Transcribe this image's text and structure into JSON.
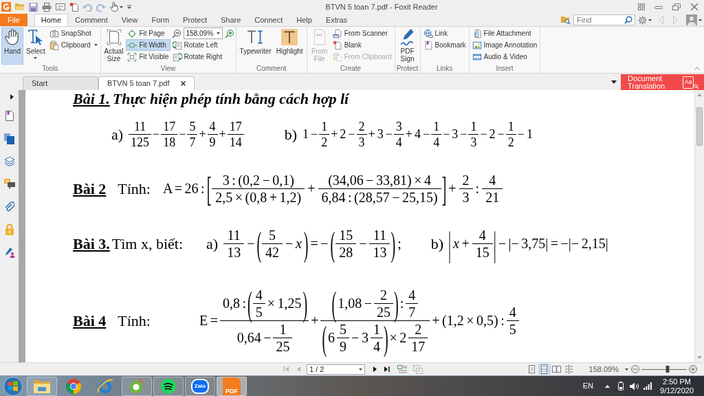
{
  "window": {
    "title": "BTVN 5 toan 7.pdf - Foxit Reader"
  },
  "ribbon_tabs": [
    {
      "label": "File",
      "kind": "file",
      "selected": false
    },
    {
      "label": "Home",
      "kind": "tab",
      "selected": true
    },
    {
      "label": "Comment",
      "kind": "tab",
      "selected": false
    },
    {
      "label": "View",
      "kind": "tab",
      "selected": false
    },
    {
      "label": "Form",
      "kind": "tab",
      "selected": false
    },
    {
      "label": "Protect",
      "kind": "tab",
      "selected": false
    },
    {
      "label": "Share",
      "kind": "tab",
      "selected": false
    },
    {
      "label": "Connect",
      "kind": "tab",
      "selected": false
    },
    {
      "label": "Help",
      "kind": "tab",
      "selected": false
    },
    {
      "label": "Extras",
      "kind": "tab",
      "selected": false
    }
  ],
  "search": {
    "placeholder": "Find"
  },
  "ribbon_groups": [
    {
      "label": "Tools",
      "columns": [
        [
          {
            "label": "Hand",
            "kind": "large",
            "selected": true,
            "disabled": false
          }
        ],
        [
          {
            "label": "Select",
            "kind": "large-menu",
            "selected": false,
            "disabled": false
          }
        ],
        [
          {
            "label": "SnapShot",
            "kind": "small",
            "selected": false,
            "disabled": false
          },
          {
            "label": "Clipboard",
            "kind": "small-menu",
            "selected": false,
            "disabled": false
          }
        ]
      ]
    },
    {
      "label": "View",
      "columns": [
        [
          {
            "label": "Actual Size",
            "kind": "large",
            "selected": false,
            "disabled": false
          }
        ],
        [
          {
            "label": "Fit Page",
            "kind": "small",
            "selected": false,
            "disabled": false
          },
          {
            "label": "Fit Width",
            "kind": "small",
            "selected": true,
            "disabled": false
          },
          {
            "label": "Fit Visible",
            "kind": "small",
            "selected": false,
            "disabled": false
          }
        ],
        [
          {
            "kind": "zoom",
            "value": "158.09%"
          },
          {
            "label": "Rotate Left",
            "kind": "small",
            "selected": false,
            "disabled": false
          },
          {
            "label": "Rotate Right",
            "kind": "small",
            "selected": false,
            "disabled": false
          }
        ]
      ]
    },
    {
      "label": "Comment",
      "columns": [
        [
          {
            "label": "Typewriter",
            "kind": "large",
            "selected": false,
            "disabled": false
          }
        ],
        [
          {
            "label": "Highlight",
            "kind": "large",
            "selected": false,
            "disabled": false
          }
        ]
      ]
    },
    {
      "label": "Create",
      "columns": [
        [
          {
            "label": "From File",
            "kind": "large",
            "selected": false,
            "disabled": true
          }
        ],
        [
          {
            "label": "From Scanner",
            "kind": "small",
            "selected": false,
            "disabled": false
          },
          {
            "label": "Blank",
            "kind": "small",
            "selected": false,
            "disabled": false
          },
          {
            "label": "From Clipboard",
            "kind": "small",
            "selected": false,
            "disabled": true
          }
        ]
      ]
    },
    {
      "label": "Protect",
      "columns": [
        [
          {
            "label": "PDF Sign",
            "kind": "large",
            "selected": false,
            "disabled": false
          }
        ]
      ]
    },
    {
      "label": "Links",
      "columns": [
        [
          {
            "label": "Link",
            "kind": "small",
            "selected": false,
            "disabled": false
          },
          {
            "label": "Bookmark",
            "kind": "small",
            "selected": false,
            "disabled": false
          }
        ]
      ]
    },
    {
      "label": "Insert",
      "columns": [
        [
          {
            "label": "File Attachment",
            "kind": "small",
            "selected": false,
            "disabled": false
          },
          {
            "label": "Image Annotation",
            "kind": "small",
            "selected": false,
            "disabled": false
          },
          {
            "label": "Audio & Video",
            "kind": "small",
            "selected": false,
            "disabled": false
          }
        ]
      ]
    }
  ],
  "document_tabs": [
    {
      "label": "Start",
      "selected": false
    },
    {
      "label": "BTVN 5 toan 7.pdf",
      "selected": true
    }
  ],
  "translation_button": {
    "label": "Document Translation",
    "symbol": "Aa"
  },
  "document": {
    "problems": [
      {
        "kind": "heading",
        "label": "Bài 1.",
        "title": "Thực hiện phép tính bằng cách hợp lí",
        "parts": [
          {
            "label": "a)",
            "formula": [
              {
                "kind": "frac",
                "num": [
                  "11"
                ],
                "den": [
                  "125"
                ]
              },
              "−",
              {
                "kind": "frac",
                "num": [
                  "17"
                ],
                "den": [
                  "18"
                ]
              },
              "−",
              {
                "kind": "frac",
                "num": [
                  "5"
                ],
                "den": [
                  "7"
                ]
              },
              "+",
              {
                "kind": "frac",
                "num": [
                  "4"
                ],
                "den": [
                  "9"
                ]
              },
              "+",
              {
                "kind": "frac",
                "num": [
                  "17"
                ],
                "den": [
                  "14"
                ]
              }
            ]
          },
          {
            "label": "b)",
            "formula": [
              "1 −",
              {
                "kind": "frac",
                "num": [
                  "1"
                ],
                "den": [
                  "2"
                ]
              },
              "+ 2 −",
              {
                "kind": "frac",
                "num": [
                  "2"
                ],
                "den": [
                  "3"
                ]
              },
              "+ 3 −",
              {
                "kind": "frac",
                "num": [
                  "3"
                ],
                "den": [
                  "4"
                ]
              },
              "+ 4 −",
              {
                "kind": "frac",
                "num": [
                  "1"
                ],
                "den": [
                  "4"
                ]
              },
              "− 3 −",
              {
                "kind": "frac",
                "num": [
                  "1"
                ],
                "den": [
                  "3"
                ]
              },
              "− 2 −",
              {
                "kind": "frac",
                "num": [
                  "1"
                ],
                "den": [
                  "2"
                ]
              },
              "− 1"
            ]
          }
        ]
      },
      {
        "kind": "inline",
        "label": "Bài 2",
        "title": "Tính:",
        "parts": [
          {
            "formula": [
              "A = 26 :",
              {
                "kind": "group",
                "open": "[",
                "close": "]",
                "body": [
                  {
                    "kind": "frac",
                    "num": [
                      "3 : (0,2 − 0,1)"
                    ],
                    "den": [
                      "2,5 × (0,8 + 1,2)"
                    ]
                  },
                  "+",
                  {
                    "kind": "frac",
                    "num": [
                      "(34,06 − 33,81) × 4"
                    ],
                    "den": [
                      "6,84 : (28,57 − 25,15)"
                    ]
                  }
                ]
              },
              "+",
              {
                "kind": "frac",
                "num": [
                  "2"
                ],
                "den": [
                  "3"
                ]
              },
              ":",
              {
                "kind": "frac",
                "num": [
                  "4"
                ],
                "den": [
                  "21"
                ]
              }
            ]
          }
        ]
      },
      {
        "kind": "inline",
        "label": "Bài 3.",
        "title": "Tìm x, biết:",
        "parts": [
          {
            "label": "a)",
            "formula": [
              {
                "kind": "frac",
                "num": [
                  "11"
                ],
                "den": [
                  "13"
                ]
              },
              "−",
              {
                "kind": "group",
                "open": "(",
                "close": ")",
                "body": [
                  {
                    "kind": "frac",
                    "num": [
                      "5"
                    ],
                    "den": [
                      "42"
                    ]
                  },
                  "− *x*"
                ]
              },
              "= −",
              {
                "kind": "group",
                "open": "(",
                "close": ")",
                "body": [
                  {
                    "kind": "frac",
                    "num": [
                      "15"
                    ],
                    "den": [
                      "28"
                    ]
                  },
                  "−",
                  {
                    "kind": "frac",
                    "num": [
                      "11"
                    ],
                    "den": [
                      "13"
                    ]
                  }
                ]
              },
              ";"
            ]
          },
          {
            "label": "b)",
            "formula": [
              {
                "kind": "group",
                "open": "|",
                "close": "|",
                "body": [
                  "*x* +",
                  {
                    "kind": "frac",
                    "num": [
                      "4"
                    ],
                    "den": [
                      "15"
                    ]
                  }
                ]
              },
              "− |− 3,75| = −|− 2,15|"
            ]
          }
        ]
      },
      {
        "kind": "inline",
        "label": "Bài 4",
        "title": "Tính:",
        "parts": [
          {
            "formula": [
              "E =",
              {
                "kind": "frac",
                "num": [
                  "0,8 :",
                  {
                    "kind": "group",
                    "open": "(",
                    "close": ")",
                    "body": [
                      {
                        "kind": "frac",
                        "num": [
                          "4"
                        ],
                        "den": [
                          "5"
                        ]
                      },
                      "× 1,25"
                    ]
                  }
                ],
                "den": [
                  "0,64 −",
                  {
                    "kind": "frac",
                    "num": [
                      "1"
                    ],
                    "den": [
                      "25"
                    ]
                  }
                ]
              },
              "+",
              {
                "kind": "frac",
                "num": [
                  {
                    "kind": "group",
                    "open": "(",
                    "close": ")",
                    "body": [
                      "1,08 −",
                      {
                        "kind": "frac",
                        "num": [
                          "2"
                        ],
                        "den": [
                          "25"
                        ]
                      }
                    ]
                  },
                  ":",
                  {
                    "kind": "frac",
                    "num": [
                      "4"
                    ],
                    "den": [
                      "7"
                    ]
                  }
                ],
                "den": [
                  {
                    "kind": "group",
                    "open": "(",
                    "close": ")",
                    "body": [
                      "6",
                      {
                        "kind": "frac",
                        "num": [
                          "5"
                        ],
                        "den": [
                          "9"
                        ]
                      },
                      "− 3",
                      {
                        "kind": "frac",
                        "num": [
                          "1"
                        ],
                        "den": [
                          "4"
                        ]
                      }
                    ]
                  },
                  "× 2",
                  {
                    "kind": "frac",
                    "num": [
                      "2"
                    ],
                    "den": [
                      "17"
                    ]
                  }
                ]
              },
              "+ (1,2 × 0,5) :",
              {
                "kind": "frac",
                "num": [
                  "4"
                ],
                "den": [
                  "5"
                ]
              }
            ]
          }
        ]
      }
    ]
  },
  "status_bar": {
    "nav_buttons": [
      {
        "disabled": true
      },
      {
        "disabled": true
      },
      {
        "disabled": false
      },
      {
        "disabled": false
      }
    ],
    "page": "1 / 2",
    "view_modes": [
      {
        "selected": false
      },
      {
        "selected": true
      },
      {
        "selected": false
      },
      {
        "selected": false
      }
    ],
    "zoom": "158.09%",
    "zoom_slider": {
      "level": 0.57
    }
  },
  "taskbar": {
    "apps": [
      {
        "running": true,
        "selected": false
      },
      {
        "running": false,
        "selected": false
      },
      {
        "running": false,
        "selected": false
      },
      {
        "running": true,
        "selected": false
      },
      {
        "running": true,
        "selected": false
      },
      {
        "running": true,
        "selected": false,
        "logo_text": "Zalo"
      },
      {
        "running": true,
        "selected": true,
        "logo_text": "PDF"
      }
    ],
    "language": "EN",
    "time": "2:50 PM",
    "date": "9/12/2020"
  }
}
